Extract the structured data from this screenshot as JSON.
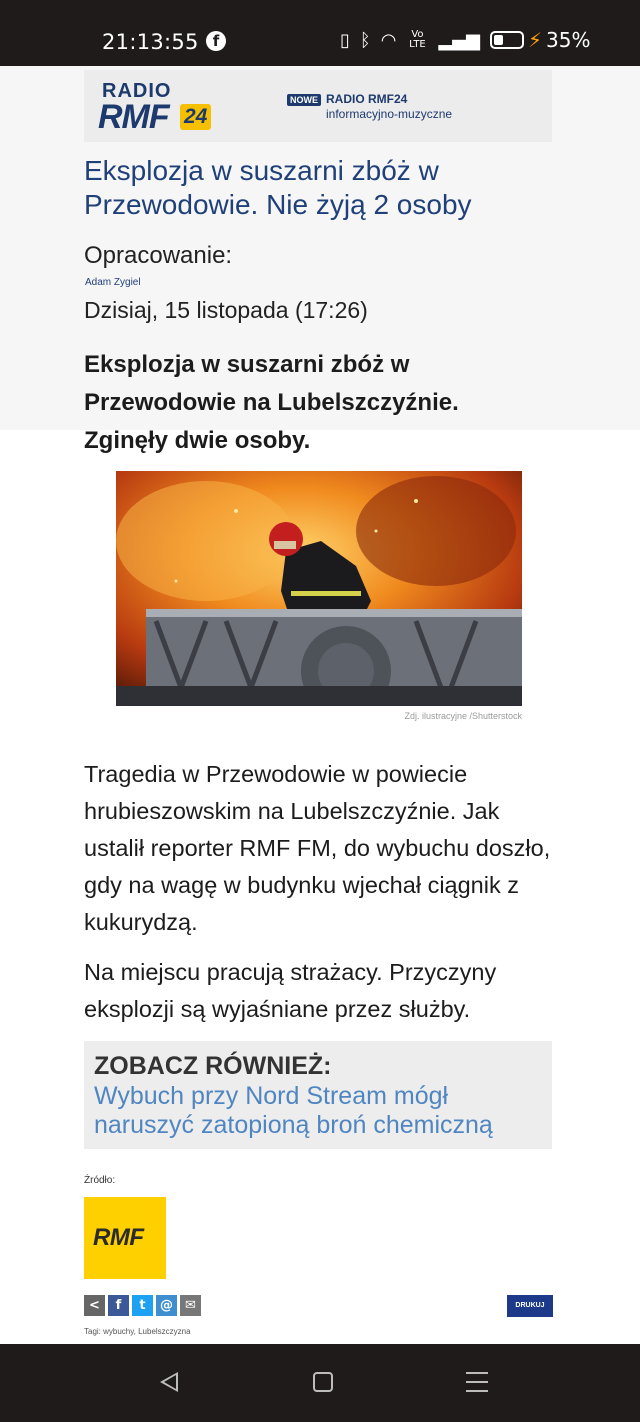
{
  "status_bar": {
    "time": "21:13:55",
    "facebook_glyph": "f",
    "battery_percent": "35%",
    "battery_level": 0.35,
    "icons": [
      "vibrate-icon",
      "bluetooth-icon",
      "wifi-icon",
      "volte-icon",
      "signal-icon",
      "battery-icon",
      "charging-icon"
    ]
  },
  "banner": {
    "logo_radio": "RADIO",
    "logo_rmf": "RMF",
    "logo_24": "24",
    "badge": "NOWE",
    "title": "RADIO RMF24",
    "subtitle": "informacyjno-muzyczne"
  },
  "article": {
    "headline": "Eksplozja w suszarni zbóż w Przewodowie. Nie żyją 2 osoby",
    "author_label": "Opracowanie:",
    "author_name": "Adam Zygiel",
    "date": "Dzisiaj, 15 listopada (17:26)",
    "lead": "Eksplozja w suszarni zbóż w Przewodowie na Lubelszczyźnie. Zginęły dwie osoby.",
    "photo_caption": "Zdj. ilustracyjne /Shutterstock",
    "paragraph_1": "Tragedia w Przewodowie w powiecie hrubieszowskim na Lubelszczyźnie. Jak ustalił reporter RMF FM, do wybuchu doszło, gdy na wagę w budynku wjechał ciągnik z kukurydzą.",
    "paragraph_2": "Na miejscu pracują strażacy. Przyczyny eksplozji są wyjaśniane przez służby."
  },
  "see_also": {
    "heading": "ZOBACZ RÓWNIEŻ:",
    "link": "Wybuch przy Nord Stream mógł naruszyć zatopioną broń chemiczną"
  },
  "source": {
    "label": "Źródło:",
    "logo_text": "RMF"
  },
  "share": {
    "print_label": "DRUKUJ",
    "buttons": [
      "<",
      "f",
      "t",
      "@",
      "✉"
    ]
  },
  "tags": "Tagi: wybuchy, Lubelszczyzna",
  "colors": {
    "brand_navy": "#1d3a6e",
    "brand_yellow": "#f6c000",
    "link_blue": "#4f86c1"
  }
}
